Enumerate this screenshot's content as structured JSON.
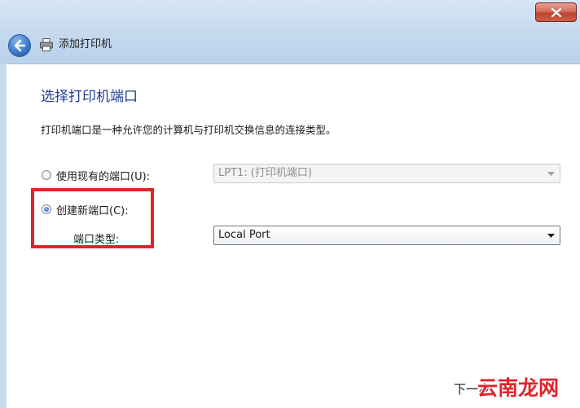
{
  "window": {
    "title": "添加打印机",
    "close_icon": "close-icon",
    "back_icon": "back-arrow-icon",
    "printer_icon": "printer-icon"
  },
  "page": {
    "heading": "选择打印机端口",
    "description": "打印机端口是一种允许您的计算机与打印机交换信息的连接类型。"
  },
  "existing_port": {
    "label": "使用现有的端口(U):",
    "selected": false,
    "dropdown_value": "LPT1: (打印机端口)",
    "enabled": false
  },
  "new_port": {
    "label": "创建新端口(C):",
    "selected": true,
    "type_label": "端口类型:",
    "dropdown_value": "Local Port",
    "enabled": true
  },
  "footer": {
    "next_label_partial": "下一步"
  },
  "watermark": {
    "text": "云南龙网"
  },
  "colors": {
    "accent": "#1f3f8f",
    "highlight": "#e0242b",
    "close_red": "#c0442d"
  }
}
